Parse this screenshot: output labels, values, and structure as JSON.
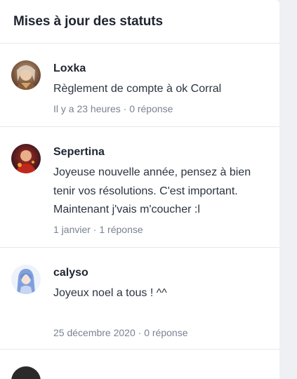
{
  "widget": {
    "title": "Mises à jour des statuts"
  },
  "statuses": [
    {
      "author": "Loxka",
      "message": "Règlement de compte à ok Corral",
      "time": "Il y a 23 heures",
      "separator": " · ",
      "replies": "0 réponse",
      "avatar_icon": "user-avatar"
    },
    {
      "author": "Sepertina",
      "message": "Joyeuse nouvelle année, pensez à bien tenir vos résolutions. C'est important. Maintenant j'vais m'coucher :l",
      "time": "1 janvier",
      "separator": " · ",
      "replies": "1 réponse",
      "avatar_icon": "user-avatar"
    },
    {
      "author": "calyso",
      "message": "Joyeux noel a tous ! ^^",
      "time": "25 décembre 2020",
      "separator": " · ",
      "replies": "0 réponse",
      "avatar_icon": "user-avatar"
    }
  ],
  "colors": {
    "background": "#eef0f4",
    "panel": "#ffffff",
    "text": "#1e2530",
    "muted": "#7a8290",
    "divider": "#e6e8ec"
  }
}
